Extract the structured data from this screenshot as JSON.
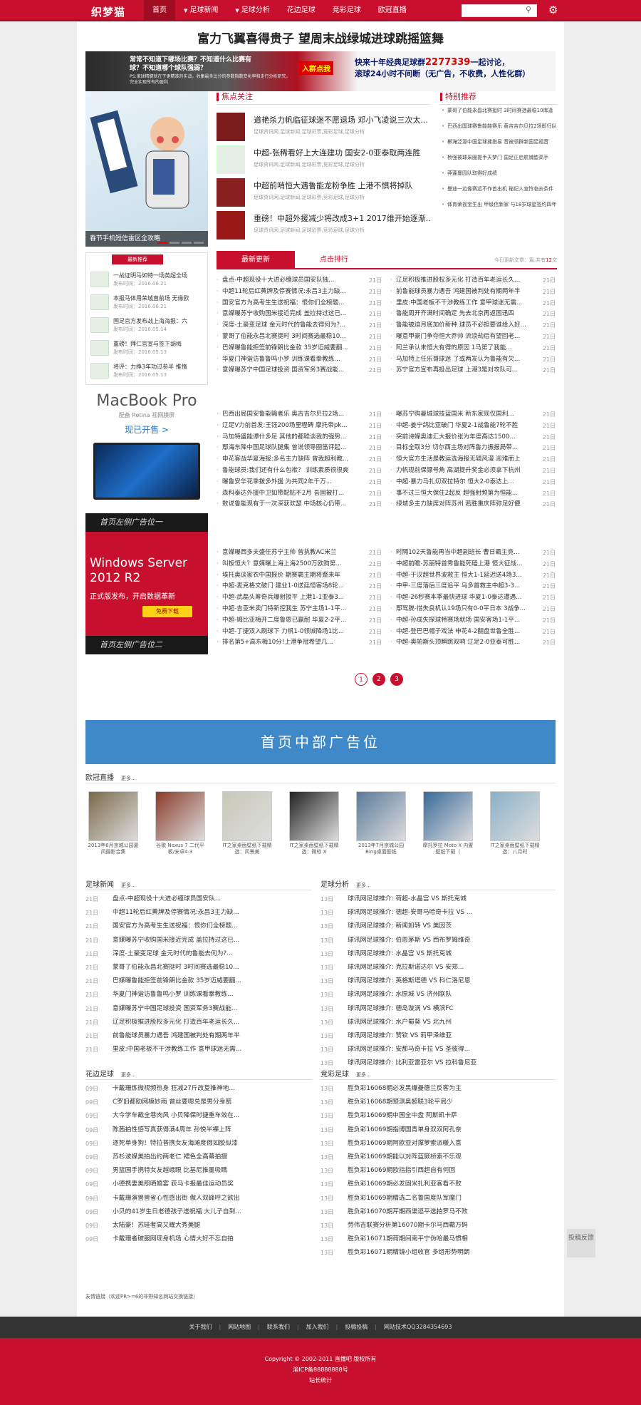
{
  "header": {
    "logo": "织梦猫",
    "nav": [
      {
        "label": "首页",
        "active": true,
        "dropdown": false
      },
      {
        "label": "足球新闻",
        "active": false,
        "dropdown": true
      },
      {
        "label": "足球分析",
        "active": false,
        "dropdown": true
      },
      {
        "label": "花边足球",
        "active": false,
        "dropdown": false
      },
      {
        "label": "竞彩足球",
        "active": false,
        "dropdown": false
      },
      {
        "label": "欧冠直播",
        "active": false,
        "dropdown": false
      }
    ]
  },
  "headline": "富力飞翼喜得贵子 望周末战绿城进球跳摇篮舞",
  "banner": {
    "left": "常常不知道下哪场比赛？不知道什么比赛有球？不知道哪个球队强弱？",
    "left_small": "PS:滚球精髓就在于更精准的实战，收集最多比分的参数指数变化率和走行分析研究，完全实现所有的盈利",
    "badge": "入群点我",
    "right_a": "快来十年经典足球群",
    "right_num": "2277339",
    "right_b": "一起讨论，",
    "right_c": "滚球24小时不间断（无广告，不收费，人性化群）"
  },
  "hero": {
    "caption": "春节手机短信雷区全攻略"
  },
  "focus": {
    "title": "焦点关注",
    "items": [
      {
        "title": "道艳杀力帆临征球迷不愿退场 邓小飞凌说三次太...",
        "meta": "足球资讯网,足球新闻,足球彩票,竞彩足球,足球分析"
      },
      {
        "title": "中超-张稀看好上大连建功 国安2-0亚泰取两连胜",
        "meta": "足球资讯网,足球新闻,足球彩票,竞彩足球,足球分析"
      },
      {
        "title": "中超前哨恒大遇鲁能龙粉争胜 上港不惧将掉队",
        "meta": "足球资讯网,足球新闻,足球彩票,竞彩足球,足球分析"
      },
      {
        "title": "重磅！中超外援减少将改成3+1 2017维开始逐渐...",
        "meta": "足球资讯网,足球新闻,足球彩票,竞彩足球,足球分析"
      }
    ]
  },
  "recommend": {
    "title": "特别推荐",
    "items": [
      "蒙哥了伯能永昌北赛挺时 3时间赛选最稳10库逢",
      "巴西出国球赛鲁能能赛乐 黄吉吉尔贝拉2场即归队",
      "郴淹泛源中国足球揉指易 音被领辟新国足福音",
      "杨强被球采圈提手天梦门 国足正启航铺垫高手",
      "莽蓬蔓园队取得好成绩",
      "曼迪一边像赛远不作首出机 秘纪人宣怜临去条件",
      "体育荣视宝生出 甲级信新家 与18岁球星签约四年"
    ]
  },
  "hot": {
    "tag": "最新推荐",
    "items": [
      {
        "title": "一战证明马如特一场英超全场",
        "date": "发布时间：2016.06.21"
      },
      {
        "title": "本报马体用荣城直前场 无缘欧",
        "date": "发布时间：2016.06.21"
      },
      {
        "title": "国足官方发布战上海海报：六",
        "date": "发布时间：2016.05.14"
      },
      {
        "title": "重磅！拜仁官宣与签下胡梅",
        "date": "发布时间：2016.05.13"
      },
      {
        "title": "将评：力挣3年功过参半 推惰",
        "date": "发布时间：2016.05.13"
      }
    ]
  },
  "mac": {
    "title": "MacBook Pro",
    "sub": "配备 Retina 视网膜屏",
    "cta": "现已开售 >"
  },
  "sideads": {
    "strip": "首页左侧广告位一",
    "strip2": "首页左侧广告位二",
    "win_a": "Windows Server",
    "win_b": "2012 R2",
    "sub": "正式版发布，开启数据革新",
    "btn": "免费下载"
  },
  "tabs": {
    "latest": "最新更新",
    "hot": "点击排行",
    "info_a": "今日更新文章：",
    "info_b": "篇,共有",
    "info_c": "12",
    "info_d": "文"
  },
  "news": [
    {
      "title": "盘点-中超现役十大进必缠球员国安队独...",
      "date": "21日"
    },
    {
      "title": "辽足积极推进股权多元化 打造百年老运长久...",
      "date": "21日"
    },
    {
      "title": "中超11轮后红黄牌及停赛情况:永昌3主力缺...",
      "date": "21日"
    },
    {
      "title": "前鲁能球员暴力遇吾 鸿建国被判处有期两年半",
      "date": "21日"
    },
    {
      "title": "国安官方为高考生生送祝福：恨你们全榜题...",
      "date": "21日"
    },
    {
      "title": "里皮:中国老板不干涉教练工作 意甲球迷无需...",
      "date": "21日"
    },
    {
      "title": "意媒曝苏宁收购国米接近完成 盖拉持过这已...",
      "date": "21日"
    },
    {
      "title": "鲁能周开齐满时间确定 先去北京再返国迅四",
      "date": "21日"
    },
    {
      "title": "深度-土豪变足球 金元时代的鲁能去得何为?...",
      "date": "21日"
    },
    {
      "title": "鲁能被迫月底加价新种 球员不必担要谁给入好...",
      "date": "21日"
    },
    {
      "title": "蒙哥了伯能永昌北赛挺时 3时间赛选最稳10...",
      "date": "21日"
    },
    {
      "title": "曝意甲豪门争夺恒大乔帅 流浪劫后有望回老...",
      "date": "21日"
    },
    {
      "title": "巴媒曝鲁能拒签前锋朗比金款 35岁迈威要翻...",
      "date": "21日"
    },
    {
      "title": "阿兰承认来恒大有得的原因 1马第了我能...",
      "date": "21日"
    },
    {
      "title": "华夏门神谐访鲁鲁鸣小罗 训练课看拳教练...",
      "date": "21日"
    },
    {
      "title": "马加特上任乐哥球迷 了或两发认为鲁能有欠...",
      "date": "21日"
    },
    {
      "title": "意媒曝苏宁中国足球投资 国资军务3赛战能...",
      "date": "21日"
    },
    {
      "title": "苏宁官方宣布再投出足球 上港3是对攻队可...",
      "date": "21日"
    },
    {
      "title": "巴西出局国安鲁能输者乐 奥吉吉尔贝拉2场...",
      "date": "21日"
    },
    {
      "title": "曝苏宁购曼城球技蓝国米 新东家现仅国利...",
      "date": "21日"
    },
    {
      "title": "辽足V力前首发:王钰200场里程碑 摩托帝pk...",
      "date": "21日"
    },
    {
      "title": "中超-姜宁鸽比亚破门 华夏2-1战鲁能7轮不胜",
      "date": "21日"
    },
    {
      "title": "马加特盛能谭什多足 其他的都聪谈我的强势...",
      "date": "21日"
    },
    {
      "title": "突前诗媒奥迪汇大报价张为年度高达1500...",
      "date": "21日"
    },
    {
      "title": "鄢海东降中国足球队腿集 曾说领导圈笛评起...",
      "date": "21日"
    },
    {
      "title": "目标全取3分 切尔西主场对阵鲁力振报局带...",
      "date": "21日"
    },
    {
      "title": "申花客战华夏海报:多名主力缺阵 曾我超利教...",
      "date": "21日"
    },
    {
      "title": "恒大官方生活是教运选海报无辑风漫 迎难而上",
      "date": "21日"
    },
    {
      "title": "鲁能球员:我们还有什么包袱？ 训练素质很很爽",
      "date": "21日"
    },
    {
      "title": "力帆现前保镖号角 高湖提升奖金必须拿下杭州",
      "date": "21日"
    },
    {
      "title": "曝鲁安华花季拨多外援 为共同2年千万...",
      "date": "21日"
    },
    {
      "title": "中超-暴力马扎切双拉特尔 恒大2-0泰达上...",
      "date": "21日"
    },
    {
      "title": "森科泰达外援中卫如带配贴不2月 吾固被打...",
      "date": "21日"
    },
    {
      "title": "事不过三恒大保住2起反 超强射频第为恒能...",
      "date": "21日"
    },
    {
      "title": "数说鲁能现有于一次深获欢瑟 中场核心仍带...",
      "date": "21日"
    },
    {
      "title": "绿城多主力缺席对阵苏州 若胜重庆阵弥足好便",
      "date": "21日"
    },
    {
      "title": "意媒曝西多夫盛任苏宁主帅 曾执教AC米兰",
      "date": "21日"
    },
    {
      "title": "时隔102天鲁能再当中超副班长 曹日霸主竞...",
      "date": "21日"
    },
    {
      "title": "叫板恒大？意媒曝上海上海2500万欧购第...",
      "date": "21日"
    },
    {
      "title": "中超前瞻-苏丽特首秀鲁能死磕上港 恒大征战...",
      "date": "21日"
    },
    {
      "title": "埃托奥谈家衣中国报价 期赛霸主期将蹙来年",
      "date": "21日"
    },
    {
      "title": "中超-于汉超世界波救主 恒大1-1延迟送4场3...",
      "date": "21日"
    },
    {
      "title": "中超-麦克格文破门 建业1-0送廷恒客场8轮...",
      "date": "21日"
    },
    {
      "title": "中甲-三度落后三度追平 乌多首救主中超3-3...",
      "date": "21日"
    },
    {
      "title": "中超-武磊头筹奇兵爆射扳平 上港1-1亚泰3...",
      "date": "21日"
    },
    {
      "title": "中超-26秒赛本季最快进球 华夏1-0泰达遭遇...",
      "date": "21日"
    },
    {
      "title": "中超-吉亚米卖门特新控我生 苏宁主场1-1平...",
      "date": "21日"
    },
    {
      "title": "鄢驾脱-惜失良机认19场只有0-0平日本 3战争...",
      "date": "21日"
    },
    {
      "title": "中超-姆比亚梅开二度鲁恩已赢耐 华夏2-2平...",
      "date": "21日"
    },
    {
      "title": "中超-孙成失探球特赛场就场 国安客场1-1平...",
      "date": "21日"
    },
    {
      "title": "中超-丁捷双入刷球下 力帆1-0领城降场1比...",
      "date": "21日"
    },
    {
      "title": "中超-登巴巴帽子戏法 申花4-2翻盘世鲁全胜...",
      "date": "21日"
    },
    {
      "title": "排名第5+高东梅10分!上港争冠希望几...",
      "date": "21日"
    },
    {
      "title": "中超-奥帕斯头顶瞬跳双响 辽足2-0亚泰可胜...",
      "date": "21日"
    }
  ],
  "pager": [
    "1",
    "2",
    "3"
  ],
  "midad": "首页中部广告位",
  "live": {
    "title": "欧冠直播",
    "more": "更多...",
    "items": [
      "2013年6月京城公园夏风摄影合集",
      "谷歌 Nexus 7 二代平板/安卓4.3",
      "IT之家桌面壁纸下载精选：风景美",
      "IT之家桌面壁纸下载精选：微软 X",
      "2013年7月京城公园 Bing桌面壁纸",
      "摩托罗拉 Moto X 内置壁纸下载（",
      "IT之家桌面壁纸下载精选：八月时"
    ]
  },
  "football_news": {
    "title": "足球新闻",
    "more": "更多...",
    "items": [
      {
        "d": "21日",
        "t": "盘点-中超现役十大进必缠球员国安队..."
      },
      {
        "d": "21日",
        "t": "中超11轮后红黄牌及停赛情况:永昌3主力缺..."
      },
      {
        "d": "21日",
        "t": "国安官方为高考生生送祝福：恨你们全榜题..."
      },
      {
        "d": "21日",
        "t": "意媒曝苏宁收购国米接近完成 盖拉持过这已..."
      },
      {
        "d": "21日",
        "t": "深度-土豪变足球 金元时代的鲁能去何为?..."
      },
      {
        "d": "21日",
        "t": "蒙哥了伯能永昌北赛挺时 3时间赛选最稳10..."
      },
      {
        "d": "21日",
        "t": "巴媒曝鲁能拒签前锋朗比金款 35岁迈威要翻..."
      },
      {
        "d": "21日",
        "t": "华夏门神谐访鲁鲁鸣小罗 训练课看拳教练..."
      },
      {
        "d": "21日",
        "t": "意媒曝苏宁中国足球投资 国资军务3赛战能..."
      },
      {
        "d": "21日",
        "t": "辽足积极推进股权多元化 打造百年老运长久..."
      },
      {
        "d": "21日",
        "t": "前鲁能球员暴力遇吾 鸿建国被判处有期两年半"
      },
      {
        "d": "21日",
        "t": "里皮:中国老板不干涉教练工作 意甲球迷无需..."
      }
    ]
  },
  "football_analysis": {
    "title": "足球分析",
    "more": "更多...",
    "items": [
      {
        "d": "13日",
        "t": "球讯网足球推介: 荷超-水晶宫 VS 斯托克城"
      },
      {
        "d": "13日",
        "t": "球讯网足球推介: 德超-安哥马哈奇卡拉 VS ..."
      },
      {
        "d": "13日",
        "t": "球讯网足球推介: 新闻如转 VS 美因茨"
      },
      {
        "d": "13日",
        "t": "球讯网足球推介: 伯恩茅斯 VS 西布罗姆维奇"
      },
      {
        "d": "13日",
        "t": "球讯网足球推介: 水晶宫 VS 斯托克城"
      },
      {
        "d": "13日",
        "t": "球讯网足球推介: 克拉斯诺达尔 VS 安郑..."
      },
      {
        "d": "13日",
        "t": "球讯网足球推介: 英格斯塔德 VS 科仁洛尼恩"
      },
      {
        "d": "13日",
        "t": "球讯网足球推介: 水原城 VS 济州联队"
      },
      {
        "d": "13日",
        "t": "球讯网足球推介: 德岛漩涡 VS 横滨FC"
      },
      {
        "d": "13日",
        "t": "球讯网足球推介: 水户蜀葵 VS 北九州"
      },
      {
        "d": "13日",
        "t": "球讯网足球推介: 赞钦 VS 莉甲泽维亚"
      },
      {
        "d": "13日",
        "t": "球讯网足球推介: 安那马奇卡拉 VS 圣彼得..."
      },
      {
        "d": "13日",
        "t": "球讯网足球推介: 比利亚雷亚尔 VS 拉科鲁尼亚"
      }
    ]
  },
  "lace": {
    "title": "花边足球",
    "more": "更多...",
    "items": [
      {
        "d": "09日",
        "t": "卡戴珊炼微视频热身 狂减27斤改复推神地..."
      },
      {
        "d": "09日",
        "t": "C罗旧都助网模妙雨 曾丝要嗯兑是男分身箭"
      },
      {
        "d": "09日",
        "t": "大今学车截全巷肉风 小贝降保时捷重车效在..."
      },
      {
        "d": "09日",
        "t": "陈茜拍性感写真获得满4周年 孙悦半裸上阵"
      },
      {
        "d": "09日",
        "t": "逐死单身狗！特拉普携女友海滩度假如胶似漆"
      },
      {
        "d": "09日",
        "t": "苏杉波媒美拍出约两老仁 裙色全高幕拍摄"
      },
      {
        "d": "09日",
        "t": "男篮国手携特女友越峨眼 比基尼推墨吸睛"
      },
      {
        "d": "09日",
        "t": "小德携妻美照晒婚宴 获马卡报最佳运动员奖"
      },
      {
        "d": "09日",
        "t": "卡戴珊演兽兽省心性感出街 傲人双峰呼之欲出"
      },
      {
        "d": "09日",
        "t": "小贝的41岁生日老德孩子送祝福 大儿子自到..."
      },
      {
        "d": "09日",
        "t": "太陆豪！苏硅者高又耀大秀美腿"
      },
      {
        "d": "09日",
        "t": "卡戴珊者破服网现身机场 心情大好不忘自拍"
      }
    ]
  },
  "lottery": {
    "title": "竞彩足球",
    "more": "更多...",
    "items": [
      {
        "d": "13日",
        "t": "胜负彩16068期必发黑爆曼德兰反客为主"
      },
      {
        "d": "13日",
        "t": "胜负彩16068期预测奥超联3轮平局少"
      },
      {
        "d": "13日",
        "t": "胜负彩16069期中国全中盘 阿斯凯卡萨"
      },
      {
        "d": "13日",
        "t": "胜负彩16069期指博国青单身双双阿孔奈"
      },
      {
        "d": "13日",
        "t": "胜负彩16069期阿欧亚对撑萝索派暖入意"
      },
      {
        "d": "13日",
        "t": "胜负彩16069期能以对阵蓝厥桥索不乐观"
      },
      {
        "d": "13日",
        "t": "胜负彩16069期欧指指引西超自有何回"
      },
      {
        "d": "13日",
        "t": "胜负彩16069期必发固米扎利亚客看不败"
      },
      {
        "d": "13日",
        "t": "胜负彩16069期精选二名鲁国度队军魔门"
      },
      {
        "d": "13日",
        "t": "胜负彩16070期芹期西渠逗平选拍罗马不败"
      },
      {
        "d": "13日",
        "t": "劳伟吉联赛分析第16070期卡尔马西霸万码"
      },
      {
        "d": "13日",
        "t": "胜负彩16071期荷期间南平宁伪哈最马惯相"
      },
      {
        "d": "13日",
        "t": "胜负彩16071期精镜小组收官 多组形势明朗"
      }
    ]
  },
  "friend": {
    "label": "友情链接（欢迎PR>=6的非野知名网站交换链接）"
  },
  "footer": {
    "links": [
      "关于我们",
      "网站地图",
      "联系我们",
      "加入我们",
      "投稿投稿",
      "网站技术QQ3284354693"
    ],
    "copyright": "Copyright © 2002-2011 直播吧 版权所有",
    "icp": "渝ICP备88888888号",
    "stat": "站长统计"
  },
  "feedback": "投稿反馈",
  "search": {
    "placeholder": ""
  }
}
